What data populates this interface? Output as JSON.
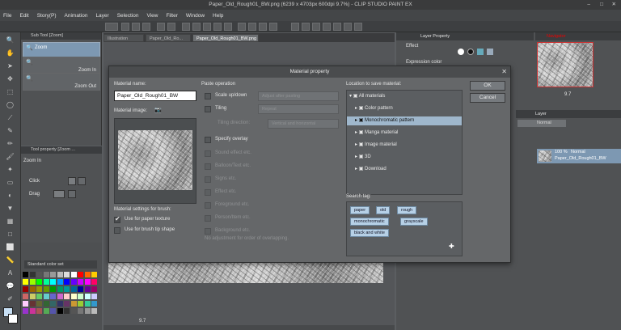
{
  "window": {
    "title": "Paper_Old_Rough01_BW.png (6239 x 4703px 600dpi 9.7%) - CLIP STUDIO PAINT EX"
  },
  "menu": [
    "File",
    "Edit",
    "Story(P)",
    "Animation",
    "Layer",
    "Selection",
    "View",
    "Filter",
    "Window",
    "Help"
  ],
  "tabs": [
    {
      "label": "Illustration"
    },
    {
      "label": "Paper_Old_Ro..."
    },
    {
      "label": "Paper_Old_Rough01_BW.png"
    }
  ],
  "subtool": {
    "title": "Sub Tool [Zoom]",
    "items": [
      "Zoom",
      "Zoom In",
      "Zoom Out"
    ]
  },
  "toolprop": {
    "title": "Tool property [Zoom ...",
    "name": "Zoom In",
    "click_label": "Click",
    "drag_label": "Drag"
  },
  "colorset": {
    "label": "Standard color set"
  },
  "zoom_value": "9.7",
  "right": {
    "layer_property_tab": "Layer Property",
    "navigator_tab": "Navigator",
    "effect_label": "Effect",
    "expression_color_label": "Expression color",
    "layer_tab": "Layer",
    "blend_mode": "Normal",
    "nav_zoom": "9.7",
    "layer": {
      "opacity": "100 %",
      "mode": "Normal",
      "name": "Paper_Old_Rough01_BW"
    }
  },
  "dialog": {
    "title": "Material property",
    "material_name_label": "Material name:",
    "material_name_value": "Paper_Old_Rough01_BW",
    "material_image_label": "Material image:",
    "paste_operation_label": "Paste operation",
    "scale_label": "Scale up/down",
    "adjust_label": "Adjust after pasting",
    "tiling_label": "Tiling",
    "repeat_label": "Repeat",
    "tiling_direction_label": "Tiling direction:",
    "vertical_horizontal_label": "Vertical and horizontal",
    "specify_overlay_label": "Specify overlay",
    "overlay_items": [
      "Sound effect etc.",
      "Balloon/Text etc.",
      "Signs etc.",
      "Effect etc.",
      "Foreground etc.",
      "Person/Item etc.",
      "Background etc."
    ],
    "no_adjustment_label": "No adjustment for order of overlapping.",
    "brush_settings_label": "Material settings for brush:",
    "use_paper_label": "Use for paper texture",
    "use_brush_tip_label": "Use for brush tip shape",
    "location_label": "Location to save material:",
    "tree": [
      "All materials",
      "Color pattern",
      "Monochromatic pattern",
      "Manga material",
      "Image material",
      "3D",
      "Download"
    ],
    "search_tag_label": "Search tag:",
    "tags": [
      "paper",
      "old",
      "rough",
      "monochromatic",
      "grayscale",
      "black and white"
    ],
    "ok_label": "OK",
    "cancel_label": "Cancel"
  }
}
